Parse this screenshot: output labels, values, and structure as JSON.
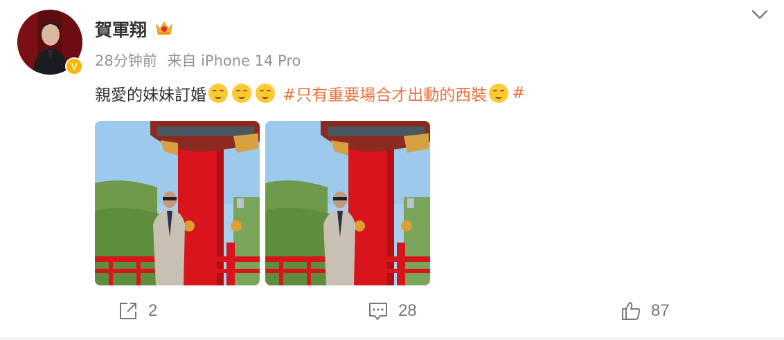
{
  "post": {
    "author": "賀軍翔",
    "time": "28分钟前",
    "source": "来自 iPhone 14 Pro",
    "text": "親愛的妹妹訂婚",
    "topic": "#只有重要場合才出動的西裝",
    "topic_end": "#"
  },
  "images": [
    {
      "icon": "photo-thumbnail"
    },
    {
      "icon": "photo-thumbnail"
    }
  ],
  "actions": {
    "share_count": "2",
    "comment_count": "28",
    "like_count": "87"
  },
  "colors": {
    "topic": "#eb7340",
    "verified_badge": "#ffb400",
    "meta_text": "#939393",
    "pillar_red": "#d8141c"
  }
}
